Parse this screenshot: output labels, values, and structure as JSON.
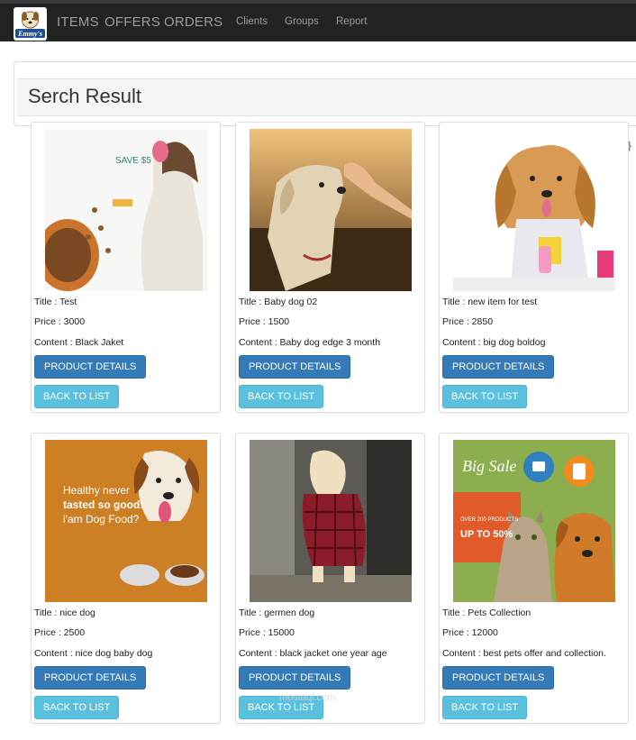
{
  "navbar": {
    "logo_text": "Emmy's",
    "items": [
      "ITEMS",
      "OFFERS",
      "ORDERS"
    ],
    "sub_items": [
      "Clients",
      "Groups",
      "Report"
    ]
  },
  "panel": {
    "title": "Serch Result"
  },
  "stray": "}",
  "buttons": {
    "details": "PRODUCT DETAILS",
    "back": "BACK TO LIST"
  },
  "products": [
    {
      "title": "Title : Test",
      "price": "Price : 3000",
      "content": "Content : Black Jaket",
      "image": "dog-food-ad-image"
    },
    {
      "title": "Title : Baby dog 02",
      "price": "Price : 1500",
      "content": "Content : Baby dog edge 3 month",
      "image": "labrador-treat-image"
    },
    {
      "title": "Title : new item for test",
      "price": "Price : 2850",
      "content": "Content : big dog boldog",
      "image": "golden-retriever-bib-image"
    },
    {
      "title": "Title : nice dog",
      "price": "Price : 2500",
      "content": "Content : nice dog baby dog",
      "image": "dog-food-banner-image"
    },
    {
      "title": "Title : germen dog",
      "price": "Price : 15000",
      "content": "Content : black jacket one year age",
      "image": "puppy-sweater-image"
    },
    {
      "title": "Title : Pets Collection",
      "price": "Price : 12000",
      "content": "Content : best pets offer and collection.",
      "image": "pets-sale-image"
    }
  ],
  "image_text": {
    "p1_save": "SAVE $5",
    "p4_line1": "Healthy never",
    "p4_line2": "tasted so good!",
    "p4_line3": "i'am Dog Food?",
    "p6_big": "Big Sale",
    "p6_over": "OVER 200 PRODUCTS",
    "p6_upto": "UP TO 50%"
  },
  "watermark": "mostaql.com"
}
